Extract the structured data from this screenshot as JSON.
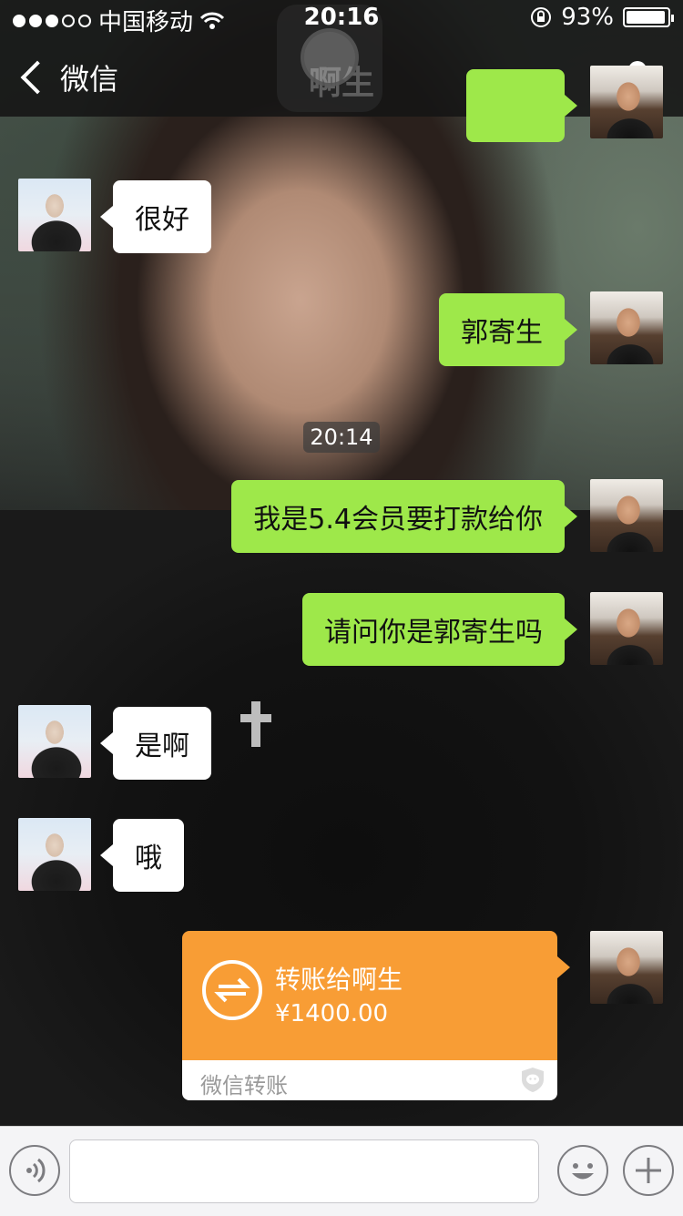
{
  "status_bar": {
    "carrier": "中国移动",
    "time": "20:16",
    "battery_percent": "93%"
  },
  "nav": {
    "back_label": "微信",
    "title": "啊生"
  },
  "messages": {
    "m1": "很好",
    "m2": "郭寄生",
    "timestamp": "20:14",
    "m3": "我是5.4会员要打款给你",
    "m4": "请问你是郭寄生吗",
    "m5": "是啊",
    "m6": "哦"
  },
  "transfer": {
    "title": "转账给啊生",
    "amount": "¥1400.00",
    "footer": "微信转账",
    "color": "#f89d35"
  },
  "colors": {
    "my_bubble": "#9ee84a",
    "other_bubble": "#ffffff"
  }
}
